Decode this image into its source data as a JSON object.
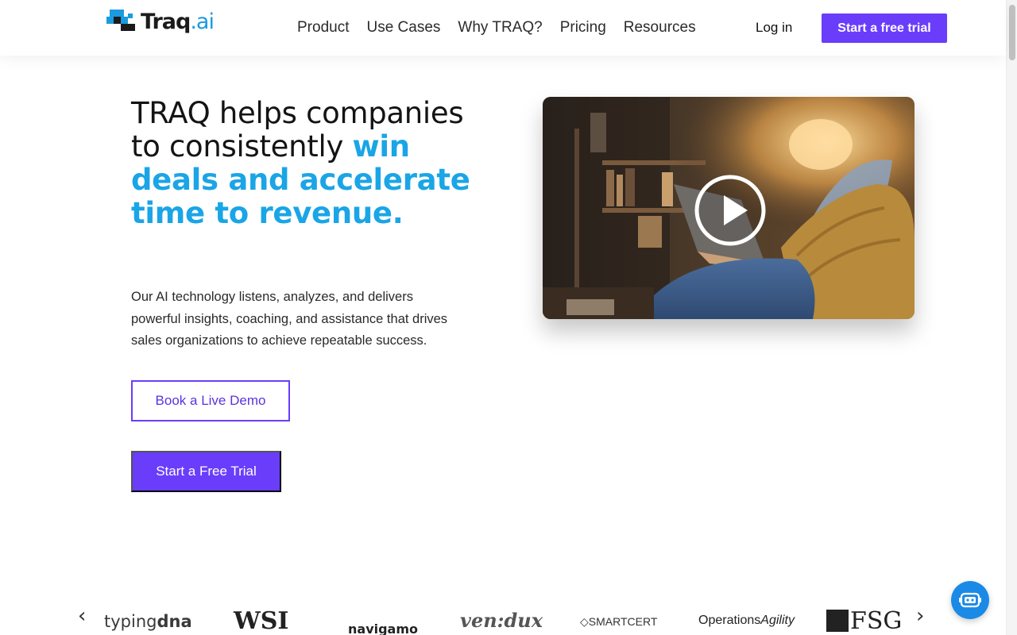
{
  "brand": {
    "name": "Traq",
    "suffix": ".ai"
  },
  "nav": {
    "items": [
      {
        "label": "Product"
      },
      {
        "label": "Use Cases"
      },
      {
        "label": "Why TRAQ?"
      },
      {
        "label": "Pricing"
      },
      {
        "label": "Resources"
      }
    ],
    "login_label": "Log in",
    "trial_label": "Start a free trial"
  },
  "hero": {
    "headline_plain": "TRAQ helps companies to consistently",
    "headline_accent": "win deals and accelerate time to revenue.",
    "lead": "Our AI technology listens, analyzes, and delivers powerful insights, coaching, and assistance that drives sales organizations to achieve repeatable success.",
    "demo_button": "Book a Live Demo",
    "trial_button": "Start a Free Trial"
  },
  "video": {
    "play_icon": "play-circle-icon"
  },
  "logos": {
    "prev_icon": "chevron-left-icon",
    "next_icon": "chevron-right-icon",
    "items": [
      {
        "text_a": "typing",
        "text_b": "dna"
      },
      {
        "text_a": "WSI"
      },
      {
        "text_a": "navigamo"
      },
      {
        "text_a": "ven:dux"
      },
      {
        "text_a": "SMARTCERT"
      },
      {
        "text_a": "Operations",
        "text_b": "Agility"
      },
      {
        "text_a": "FSG"
      }
    ]
  },
  "chat": {
    "icon": "chat-bot-icon"
  },
  "colors": {
    "accent": "#6a3dfb",
    "highlight": "#1aa5e6",
    "chat": "#1b8ae6"
  }
}
